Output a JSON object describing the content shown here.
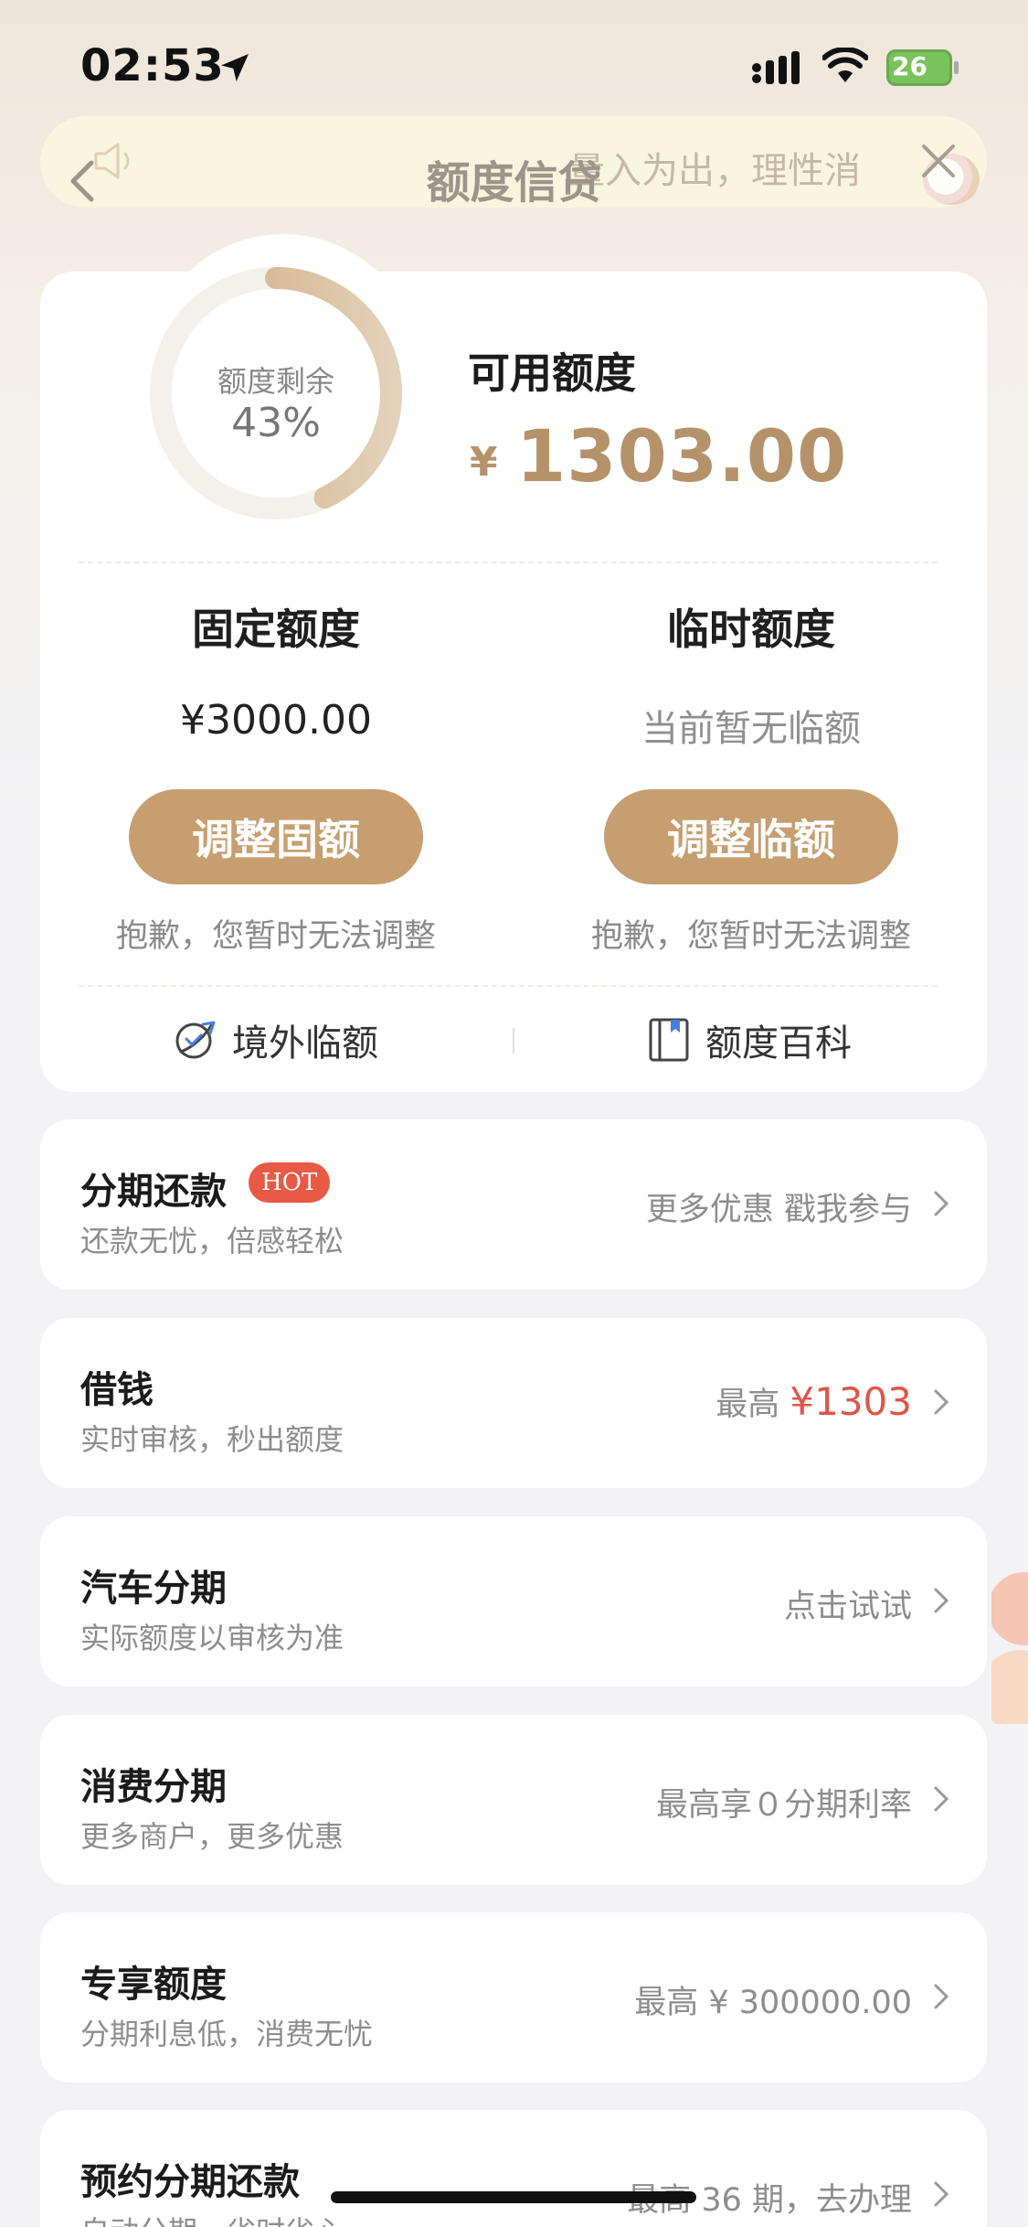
{
  "status_bar": {
    "time": "02:53",
    "battery": "26"
  },
  "header": {
    "title": "额度信贷",
    "notice": "量入为出，理性消"
  },
  "quota": {
    "ring_label": "额度剩余",
    "ring_percent": "43%",
    "ring_fraction": 0.43,
    "available_label": "可用额度",
    "currency": "¥",
    "available_amount": "1303.00",
    "fixed": {
      "title": "固定额度",
      "value": "¥3000.00",
      "button": "调整固额",
      "note": "抱歉，您暂时无法调整"
    },
    "temp": {
      "title": "临时额度",
      "value": "当前暂无临额",
      "button": "调整临额",
      "note": "抱歉，您暂时无法调整"
    },
    "links": {
      "overseas": "境外临额",
      "wiki": "额度百科"
    }
  },
  "list": [
    {
      "title": "分期还款",
      "badge": "HOT",
      "subtitle": "还款无忧，倍感轻松",
      "right": "更多优惠 戳我参与"
    },
    {
      "title": "借钱",
      "subtitle": "实时审核，秒出额度",
      "right_prefix": "最高",
      "right_highlight": "¥1303"
    },
    {
      "title": "汽车分期",
      "subtitle": "实际额度以审核为准",
      "right": "点击试试"
    },
    {
      "title": "消费分期",
      "subtitle": "更多商户，更多优惠",
      "right": "最高享０分期利率"
    },
    {
      "title": "专享额度",
      "subtitle": "分期利息低，消费无忧",
      "right": "最高 ¥ 300000.00"
    },
    {
      "title": "预约分期还款",
      "subtitle": "自动分期，省时省心",
      "right": "最高 36 期，去办理"
    }
  ],
  "colors": {
    "accent": "#c79e6f",
    "amount": "#b6926a",
    "highlight": "#e05548"
  }
}
